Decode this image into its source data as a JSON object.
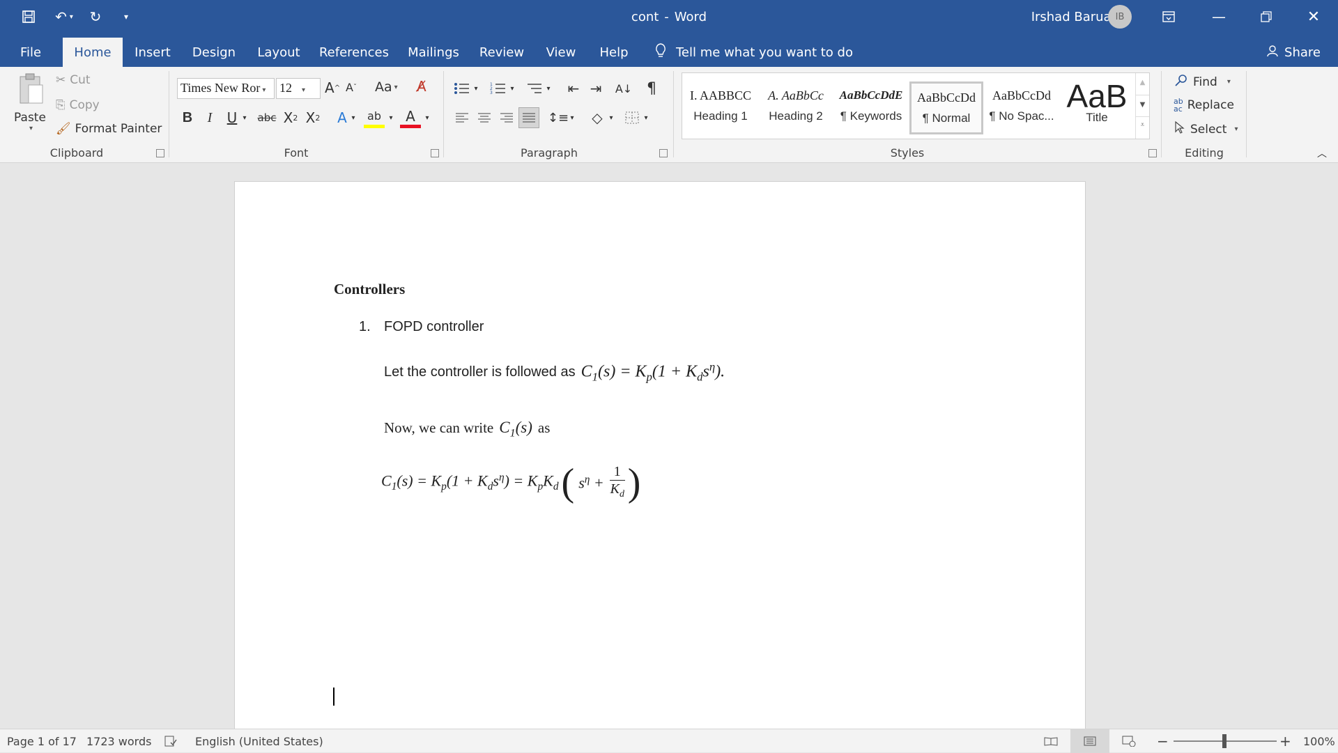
{
  "window": {
    "doc_name": "cont",
    "separator": "-",
    "app_name": "Word",
    "user": "Irshad Baruah",
    "user_initials": "IB"
  },
  "tabs": [
    {
      "label": "File"
    },
    {
      "label": "Home"
    },
    {
      "label": "Insert"
    },
    {
      "label": "Design"
    },
    {
      "label": "Layout"
    },
    {
      "label": "References"
    },
    {
      "label": "Mailings"
    },
    {
      "label": "Review"
    },
    {
      "label": "View"
    },
    {
      "label": "Help"
    }
  ],
  "tell_me": "Tell me what you want to do",
  "share": "Share",
  "clipboard": {
    "paste": "Paste",
    "cut": "Cut",
    "copy": "Copy",
    "format_painter": "Format Painter",
    "group": "Clipboard"
  },
  "font": {
    "name": "Times New Ror",
    "size": "12",
    "case": "Aa",
    "group": "Font"
  },
  "paragraph": {
    "group": "Paragraph"
  },
  "styles": {
    "group": "Styles",
    "items": [
      {
        "preview": "I. AABBCC",
        "name": "Heading 1"
      },
      {
        "preview": "A. AaBbCc",
        "name": "Heading 2"
      },
      {
        "preview": "AaBbCcDdE",
        "name": "¶ Keywords"
      },
      {
        "preview": "AaBbCcDd",
        "name": "¶ Normal"
      },
      {
        "preview": "AaBbCcDd",
        "name": "¶ No Spac..."
      },
      {
        "preview": "AaB",
        "name": "Title"
      }
    ]
  },
  "editing": {
    "find": "Find",
    "replace": "Replace",
    "select": "Select",
    "group": "Editing"
  },
  "document": {
    "heading": "Controllers",
    "item_number": "1.",
    "item_text": "FOPD controller",
    "line1": "Let the controller is followed as",
    "line2_prefix": "Now, we can write",
    "line2_suffix": "as"
  },
  "status": {
    "page": "Page 1 of 17",
    "words": "1723 words",
    "language": "English (United States)",
    "zoom": "100%"
  }
}
